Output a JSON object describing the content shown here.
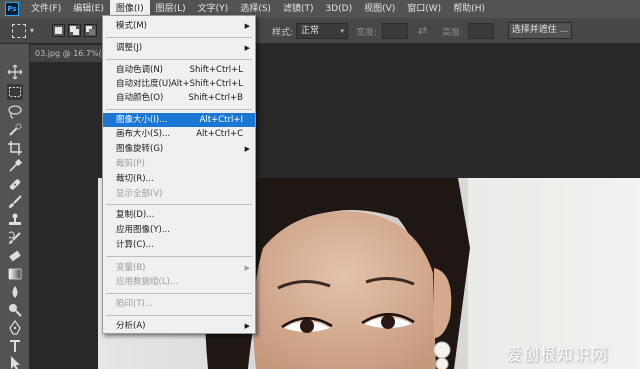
{
  "app": {
    "logo": "Ps"
  },
  "menubar": {
    "items": [
      "文件(F)",
      "编辑(E)",
      "图像(I)",
      "图层(L)",
      "文字(Y)",
      "选择(S)",
      "滤镜(T)",
      "3D(D)",
      "视图(V)",
      "窗口(W)",
      "帮助(H)"
    ],
    "active_index": 2
  },
  "options": {
    "style_label": "样式:",
    "style_value": "正常",
    "width_label": "宽度:",
    "height_label": "高度:",
    "select_mask_button": "选择并遮住 ..."
  },
  "document": {
    "tab_label": "03.jpg @ 16.7%(RGB"
  },
  "image_menu": {
    "mode": {
      "label": "模式(M)"
    },
    "adjustments": {
      "label": "调整(J)"
    },
    "auto_tone": {
      "label": "自动色调(N)",
      "shortcut": "Shift+Ctrl+L"
    },
    "auto_contrast": {
      "label": "自动对比度(U)",
      "shortcut": "Alt+Shift+Ctrl+L"
    },
    "auto_color": {
      "label": "自动颜色(O)",
      "shortcut": "Shift+Ctrl+B"
    },
    "image_size": {
      "label": "图像大小(I)...",
      "shortcut": "Alt+Ctrl+I"
    },
    "canvas_size": {
      "label": "画布大小(S)...",
      "shortcut": "Alt+Ctrl+C"
    },
    "image_rotation": {
      "label": "图像旋转(G)"
    },
    "crop": {
      "label": "裁剪(P)"
    },
    "trim": {
      "label": "裁切(R)..."
    },
    "reveal_all": {
      "label": "显示全部(V)"
    },
    "duplicate": {
      "label": "复制(D)..."
    },
    "apply_image": {
      "label": "应用图像(Y)..."
    },
    "calculations": {
      "label": "计算(C)..."
    },
    "variables": {
      "label": "变量(B)"
    },
    "apply_data_set": {
      "label": "应用数据组(L)..."
    },
    "trap": {
      "label": "陷印(T)..."
    },
    "analysis": {
      "label": "分析(A)"
    }
  },
  "watermark": {
    "text": "爱创根知识网"
  },
  "colors": {
    "menu_highlight": "#1a78d4",
    "panel": "#535353",
    "workspace": "#282828"
  }
}
